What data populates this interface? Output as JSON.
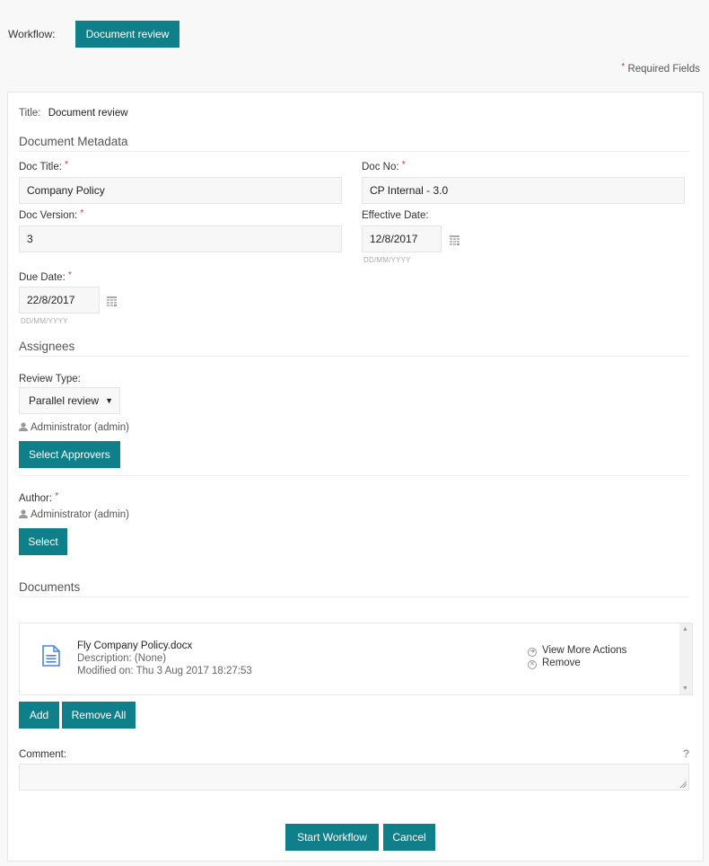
{
  "header": {
    "workflow_label": "Workflow:",
    "workflow_button": "Document review",
    "required_star": "*",
    "required_text": "Required Fields"
  },
  "form": {
    "title_label": "Title:",
    "title_value": "Document review",
    "sections": {
      "metadata": "Document Metadata",
      "assignees": "Assignees",
      "documents": "Documents"
    },
    "fields": {
      "doc_title": {
        "label": "Doc Title:",
        "value": "Company Policy",
        "required": "*"
      },
      "doc_no": {
        "label": "Doc No:",
        "value": "CP Internal - 3.0",
        "required": "*"
      },
      "doc_version": {
        "label": "Doc Version:",
        "value": "3",
        "required": "*"
      },
      "effective_date": {
        "label": "Effective Date:",
        "value": "12/8/2017",
        "hint": "DD/MM/YYYY"
      },
      "due_date": {
        "label": "Due Date:",
        "value": "22/8/2017",
        "hint": "DD/MM/YYYY",
        "required": "*"
      }
    },
    "review_type": {
      "label": "Review Type:",
      "selected": "Parallel review",
      "arrow": "▼"
    },
    "approvers": {
      "user": "Administrator (admin)",
      "button": "Select Approvers"
    },
    "author": {
      "label": "Author:",
      "required": "*",
      "user": "Administrator (admin)",
      "button": "Select"
    },
    "documents": {
      "items": [
        {
          "name": "Fly Company Policy.docx",
          "description": "Description: (None)",
          "modified": "Modified on: Thu 3 Aug 2017 18:27:53",
          "actions": [
            "View More Actions",
            "Remove"
          ]
        }
      ],
      "add_button": "Add",
      "remove_all_button": "Remove All"
    },
    "comment": {
      "label": "Comment:",
      "value": "",
      "help": "?"
    },
    "buttons": {
      "start": "Start Workflow",
      "cancel": "Cancel"
    }
  },
  "colors": {
    "accent": "#0f8089",
    "required": "#c43a3a"
  }
}
